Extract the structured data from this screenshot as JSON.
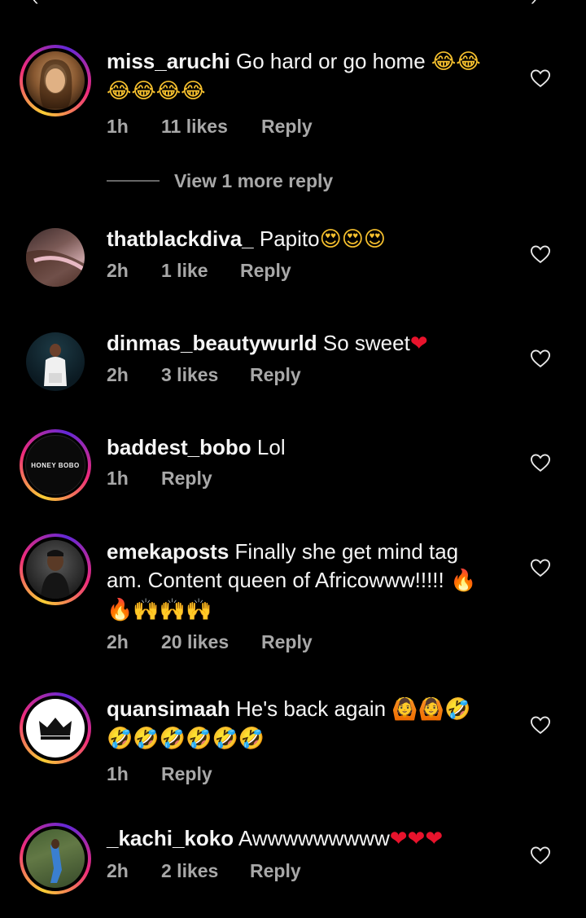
{
  "top_glyphs": {
    "left": "‹",
    "right": "›"
  },
  "colors": {
    "background": "#000000",
    "text": "#f5f5f5",
    "meta": "#a8a8a8",
    "story_ring": [
      "#f9ce34",
      "#ee2a7b",
      "#6228d7"
    ]
  },
  "comments": [
    {
      "username": "miss_aruchi",
      "text": "Go hard or go home",
      "emoji_line1": "😂😂",
      "emoji_line2": "😂😂😂😂",
      "time": "1h",
      "likes": "11 likes",
      "reply": "Reply",
      "avatar": "profile-photo-woman",
      "has_ring": true,
      "view_more": "View 1 more reply"
    },
    {
      "username": "thatblackdiva_",
      "text": "Papito",
      "emoji_line1": "😍😍😍",
      "time": "2h",
      "likes": "1 like",
      "reply": "Reply",
      "avatar": "profile-photo",
      "has_ring": false
    },
    {
      "username": "dinmas_beautywurld",
      "text": "So sweet",
      "emoji_line1": "❤",
      "time": "2h",
      "likes": "3 likes",
      "reply": "Reply",
      "avatar": "profile-photo-woman-white",
      "has_ring": false
    },
    {
      "username": "baddest_bobo",
      "text": "Lol",
      "time": "1h",
      "likes": "",
      "reply": "Reply",
      "avatar_text": "HONEY BOBO",
      "has_ring": true
    },
    {
      "username": "emekaposts",
      "text": "Finally she get mind tag",
      "text_line2": "am. Content queen of Africowww!!!!!",
      "emoji_after_line2": "🔥",
      "emoji_line3": "🔥🙌🙌🙌",
      "time": "2h",
      "likes": "20 likes",
      "reply": "Reply",
      "avatar": "profile-photo-man",
      "has_ring": true
    },
    {
      "username": "quansimaah",
      "text": "He's back again",
      "emoji_line1": "🙆🙆🤣",
      "emoji_line2": "🤣🤣🤣🤣🤣🤣",
      "time": "1h",
      "likes": "",
      "reply": "Reply",
      "avatar": "crown-logo",
      "has_ring": true
    },
    {
      "username": "_kachi_koko",
      "text": "Awwwwwwwww",
      "emoji_line1": "❤❤❤",
      "time": "2h",
      "likes": "2 likes",
      "reply": "Reply",
      "avatar": "profile-photo-woman-outdoor",
      "has_ring": true
    }
  ]
}
